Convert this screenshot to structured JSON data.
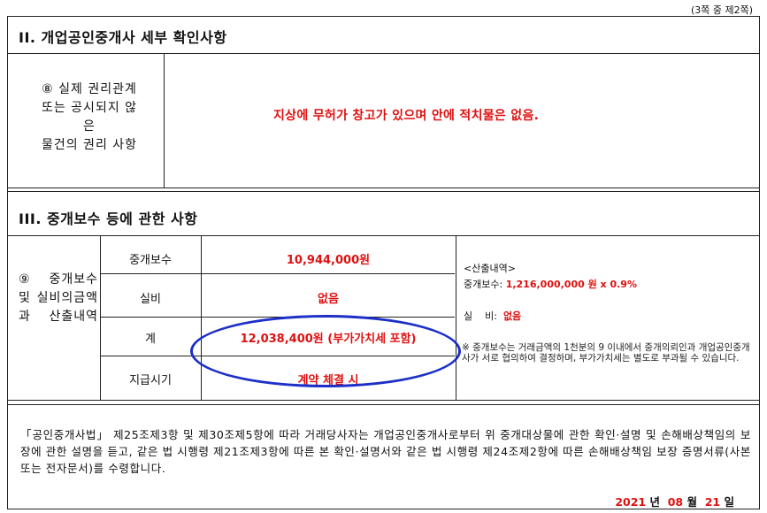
{
  "page_indicator": "(3쪽 중 제2쪽)",
  "section2": {
    "title": "II. 개업공인중개사 세부 확인사항",
    "item8_label_lines": [
      "⑧ 실제 권리관계",
      "또는 공시되지 않",
      "은",
      "물건의 권리 사항"
    ],
    "item8_value": "지상에 무허가 창고가 있으며 안에 적치물은 없음."
  },
  "section3": {
    "title": "III. 중개보수 등에 관한 사항",
    "item9_label": "⑨ 중개보수 및 실비의금액과 산출내역",
    "rows": [
      {
        "label": "중개보수",
        "value": "10,944,000원"
      },
      {
        "label": "실비",
        "value": "없음"
      },
      {
        "label": "계",
        "value": "12,038,400원 (부가가치세 포함)"
      },
      {
        "label": "지급시기",
        "value": "계약 체결 시"
      }
    ],
    "calc_title": "<산출내역>",
    "calc_fee_label": "중개보수:",
    "calc_fee_value": "1,216,000,000 원 x 0.9%",
    "calc_expense_label": "실    비:",
    "calc_expense_value": "없음",
    "note": "※ 중개보수는 거래금액의 1천분의 9 이내에서 중개의뢰인과 개업공인중개사가 서로 협의하여 결정하며, 부가가치세는 별도로 부과될 수 있습니다."
  },
  "statement": "「공인중개사법」 제25조제3항 및 제30조제5항에 따라 거래당사자는 개업공인중개사로부터 위 중개대상물에 관한 확인·설명 및 손해배상책임의 보장에 관한 설명을 듣고, 같은 법 시행령 제21조제3항에 따른 본 확인·설명서와 같은 법 시행령 제24조제2항에 따른 손해배상책임 보장 증명서류(사본 또는 전자문서)를 수령합니다.",
  "date": {
    "year": "2021",
    "year_unit": "년",
    "month": "08",
    "month_unit": "월",
    "day": "21",
    "day_unit": "일"
  },
  "colors": {
    "accent_red": "#e01010",
    "circle_blue": "#1c2fc8"
  }
}
